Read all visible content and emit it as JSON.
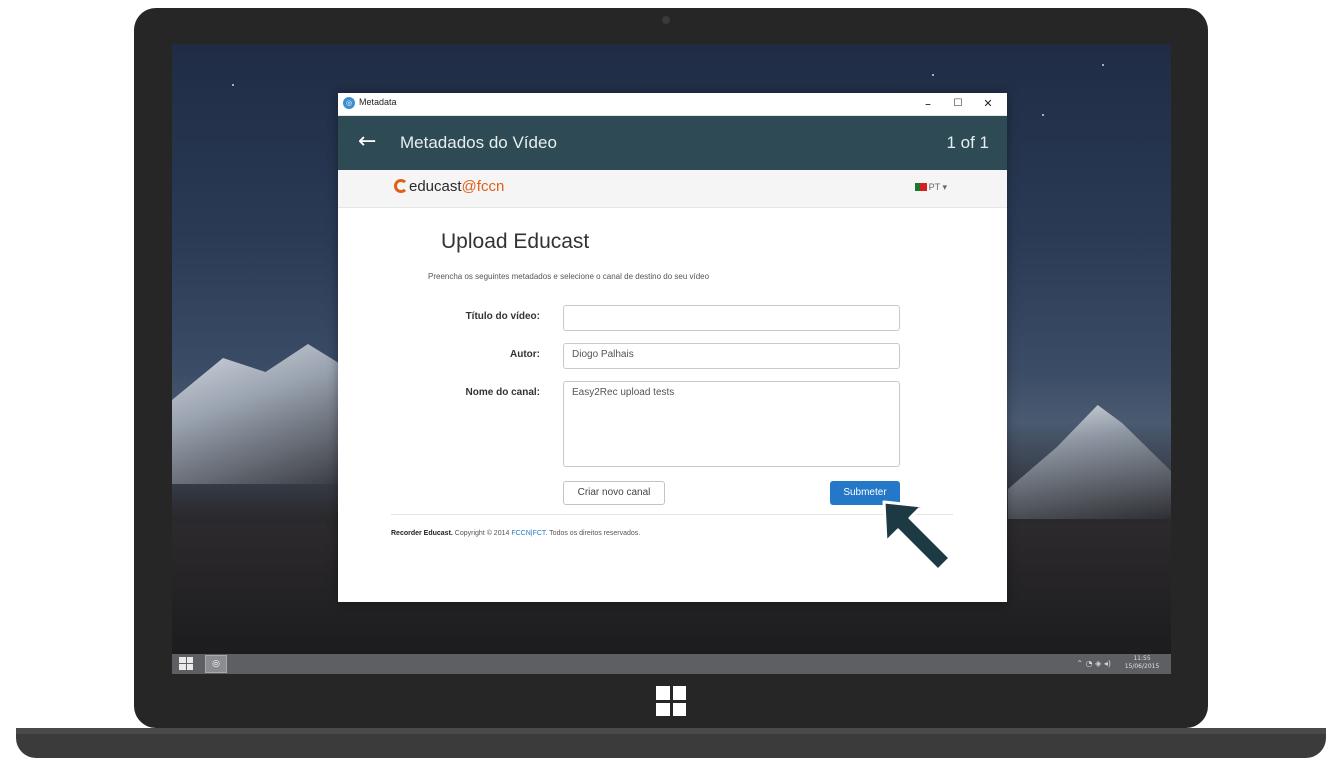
{
  "window": {
    "title": "Metadata",
    "minimize": "–",
    "maximize": "☐",
    "close": "✕"
  },
  "header": {
    "back_glyph": "←",
    "title": "Metadados do Vídeo",
    "counter": "1 of 1"
  },
  "navbar": {
    "logo_part1": "educast",
    "logo_part2": "@fccn",
    "language": "PT ▾"
  },
  "form": {
    "title": "Upload Educast",
    "intro": "Preencha os seguintes metadados e selecione o canal de destino do seu vídeo",
    "video_title_label": "Título do vídeo:",
    "video_title_value": "",
    "author_label": "Autor:",
    "author_value": "Diogo Palhais",
    "channel_label": "Nome do canal:",
    "channel_value": "Easy2Rec upload tests",
    "new_channel_button": "Criar novo canal",
    "submit_button": "Submeter"
  },
  "footer": {
    "brand": "Recorder Educast.",
    "copyright": " Copyright © 2014 ",
    "link": "FCCN|FCT",
    "rights": ". Todos os direitos reservados."
  },
  "taskbar": {
    "tray_icons": "⌃ ◔ ◈ ◂)",
    "time": "11:55",
    "date": "15/06/2015"
  },
  "colors": {
    "header_bg": "#2e4a55",
    "accent": "#2478c7",
    "brand_orange": "#e0601a"
  }
}
